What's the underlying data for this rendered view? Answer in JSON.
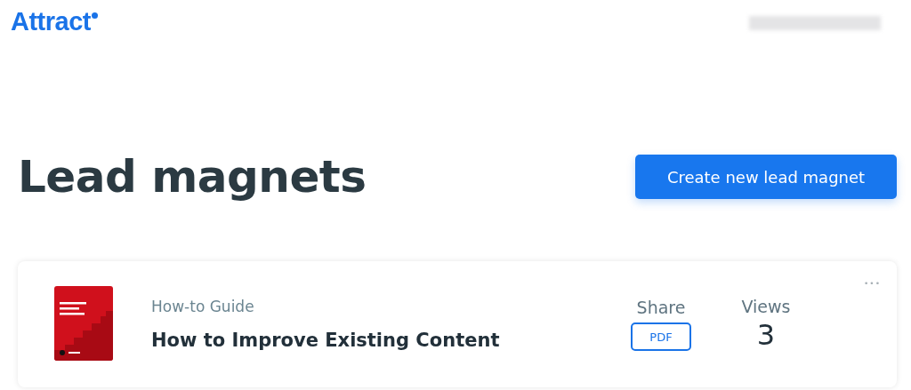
{
  "header": {
    "logo": "Attract"
  },
  "page_title": "Lead magnets",
  "create_button": "Create new lead magnet",
  "lead_magnets": [
    {
      "kind": "guide",
      "type": "How-to Guide",
      "title": "How to Improve Existing Content",
      "share_label": "Share",
      "share_button": "PDF",
      "views_label": "Views",
      "views": "3",
      "menu": "•••"
    }
  ]
}
